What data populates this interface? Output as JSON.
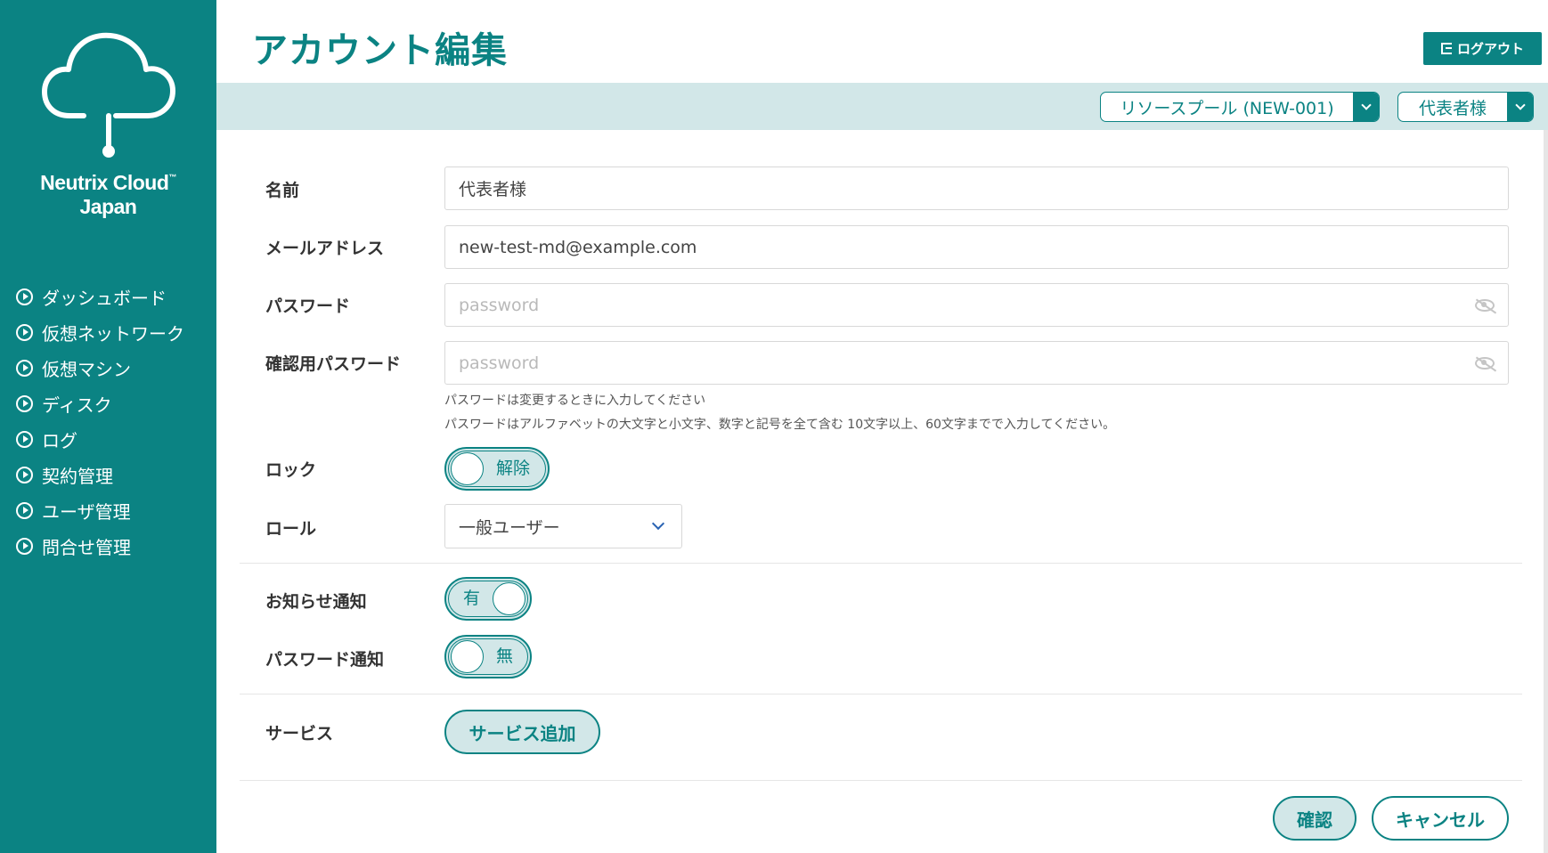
{
  "brand": {
    "line1": "Neutrix Cloud",
    "tm": "™",
    "line2": "Japan"
  },
  "sidebar": {
    "items": [
      {
        "label": "ダッシュボード"
      },
      {
        "label": "仮想ネットワーク"
      },
      {
        "label": "仮想マシン"
      },
      {
        "label": "ディスク"
      },
      {
        "label": "ログ"
      },
      {
        "label": "契約管理"
      },
      {
        "label": "ユーザ管理"
      },
      {
        "label": "問合せ管理"
      }
    ]
  },
  "header": {
    "title": "アカウント編集",
    "logout_label": "ログアウト",
    "resource_pool": "リソースプール (NEW-001)",
    "user_menu": "代表者様"
  },
  "form": {
    "name": {
      "label": "名前",
      "value": "代表者様"
    },
    "email": {
      "label": "メールアドレス",
      "value": "new-test-md@example.com"
    },
    "password": {
      "label": "パスワード",
      "placeholder": "password"
    },
    "confirm_password": {
      "label": "確認用パスワード",
      "placeholder": "password"
    },
    "password_help_1": "パスワードは変更するときに入力してください",
    "password_help_2": "パスワードはアルファベットの大文字と小文字、数字と記号を全て含む 10文字以上、60文字までで入力してください。",
    "lock": {
      "label": "ロック",
      "state": "解除"
    },
    "role": {
      "label": "ロール",
      "value": "一般ユーザー"
    },
    "notice": {
      "label": "お知らせ通知",
      "state": "有"
    },
    "password_notice": {
      "label": "パスワード通知",
      "state": "無"
    },
    "service": {
      "label": "サービス",
      "add_button": "サービス追加"
    }
  },
  "actions": {
    "confirm": "確認",
    "cancel": "キャンセル"
  },
  "colors": {
    "primary": "#0b8383",
    "light": "#d2e7e8"
  }
}
